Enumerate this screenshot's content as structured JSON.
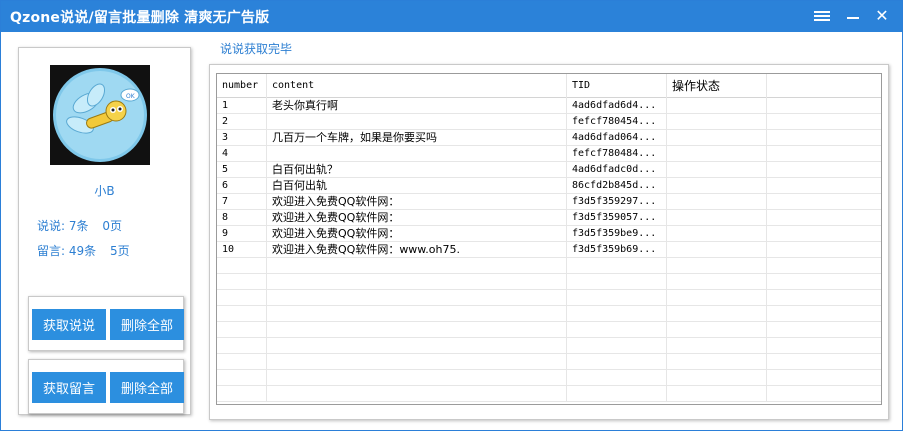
{
  "window": {
    "title": "Qzone说说/留言批量删除 清爽无广告版",
    "titlebar_color": "#2b82d9"
  },
  "profile": {
    "username": "小B",
    "shuoshuo_label": "说说:",
    "shuoshuo_count": "7条",
    "shuoshuo_pages": "0页",
    "message_label": "留言:",
    "message_count": "49条",
    "message_pages": "5页"
  },
  "buttons": {
    "fetch_shuoshuo": "获取说说",
    "delete_all_shuoshuo": "删除全部",
    "fetch_messages": "获取留言",
    "delete_all_messages": "删除全部"
  },
  "status_text": "说说获取完毕",
  "table": {
    "columns": [
      "number",
      "content",
      "TID",
      "操作状态"
    ],
    "rows": [
      {
        "number": "1",
        "content": "老头你真行啊",
        "tid": "4ad6dfad6d4...",
        "status": ""
      },
      {
        "number": "2",
        "content": "",
        "tid": "fefcf780454...",
        "status": ""
      },
      {
        "number": "3",
        "content": "几百万一个车牌，如果是你要买吗",
        "tid": "4ad6dfad064...",
        "status": ""
      },
      {
        "number": "4",
        "content": "",
        "tid": "fefcf780484...",
        "status": ""
      },
      {
        "number": "5",
        "content": "白百何出轨？",
        "tid": "4ad6dfadc0d...",
        "status": ""
      },
      {
        "number": "6",
        "content": "白百何出轨",
        "tid": "86cfd2b845d...",
        "status": ""
      },
      {
        "number": "7",
        "content": "欢迎进入免费QQ软件网：",
        "tid": "f3d5f359297...",
        "status": ""
      },
      {
        "number": "8",
        "content": "欢迎进入免费QQ软件网：",
        "tid": "f3d5f359057...",
        "status": ""
      },
      {
        "number": "9",
        "content": "欢迎进入免费QQ软件网：",
        "tid": "f3d5f359be9...",
        "status": ""
      },
      {
        "number": "10",
        "content": "欢迎进入免费QQ软件网：www.oh75.",
        "tid": "f3d5f359b69...",
        "status": ""
      }
    ]
  },
  "icons": {
    "menu": "hamburger-menu-icon",
    "minimize": "minimize-icon",
    "close": "close-icon",
    "avatar": "dragonfly-avatar"
  },
  "colors": {
    "accent": "#2c8fdf",
    "link_text": "#2d7fd2"
  }
}
